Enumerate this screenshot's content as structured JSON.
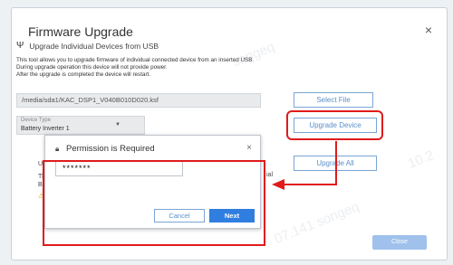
{
  "dialog": {
    "title": "Firmware Upgrade",
    "close_glyph": "×",
    "usb_section": {
      "icon": "usb-icon",
      "label": "Upgrade Individual Devices from USB"
    },
    "description": [
      "This tool allows you to upgrade firmware of individual connected device from an inserted USB.",
      "During upgrade operation this device will not provide power.",
      "After the upgrade is completed the device will restart."
    ],
    "file_path": "/media/sda1/KAC_DSP1_V040B010D020.ksf",
    "select_file_label": "Select File",
    "device_type_caption": "Device Type",
    "device_type_value": "Battery Inverter 1",
    "upgrade_device_label": "Upgrade Device",
    "upgrade_all_label": "Upgrade All",
    "close_label": "Close",
    "partial_texts": [
      "U",
      "Th",
      "B",
      "ial"
    ]
  },
  "modal": {
    "title": "Permission is Required",
    "lock_icon": "lock-icon",
    "close_glyph": "×",
    "password_value": "*******",
    "cancel_label": "Cancel",
    "next_label": "Next"
  },
  "watermarks": [
    "songeq",
    "10.2",
    "07.141 songeq"
  ],
  "colors": {
    "accent": "#2f7ee0",
    "outline_button": "#7aa5d6",
    "highlight": "#e01b1b",
    "close_button": "#9fc1ec"
  }
}
